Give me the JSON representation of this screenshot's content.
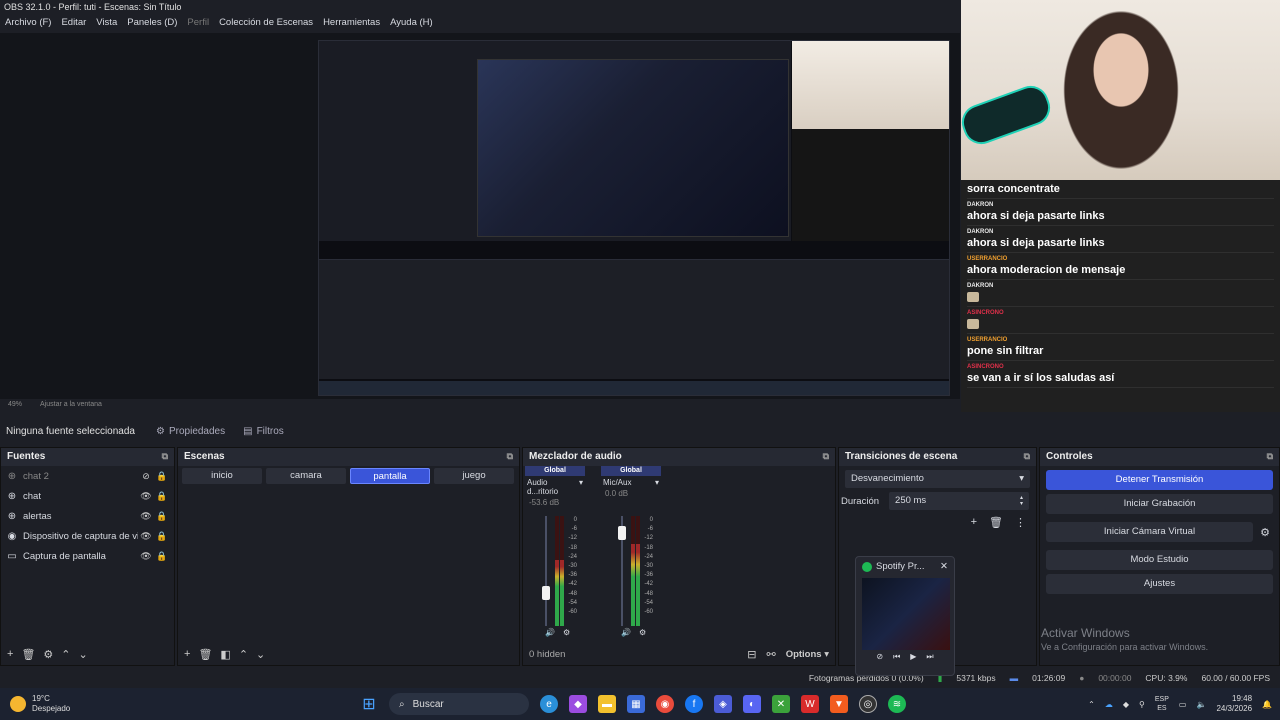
{
  "window": {
    "title": "OBS 32.1.0 - Perfil: tuti - Escenas: Sin Título"
  },
  "menu": [
    "Archivo (F)",
    "Editar",
    "Vista",
    "Paneles (D)",
    "Perfil",
    "Colección de Escenas",
    "Herramientas",
    "Ayuda (H)"
  ],
  "zoom": {
    "level": "49%",
    "fit": "Ajustar a la ventana"
  },
  "chat": {
    "messages": [
      {
        "user": "",
        "text": "sorra concentrate",
        "color": "#ffffff",
        "emote": false
      },
      {
        "user": "DAKRON",
        "text": "ahora si deja pasarte links",
        "color": "#e8e8e8",
        "emote": false
      },
      {
        "user": "DAKRON",
        "text": "ahora si deja pasarte links",
        "color": "#e8e8e8",
        "emote": false
      },
      {
        "user": "USERRANCIO",
        "text": "ahora moderacion de mensaje",
        "color": "#f0a030",
        "emote": false
      },
      {
        "user": "DAKRON",
        "text": "",
        "color": "#e8e8e8",
        "emote": true
      },
      {
        "user": "ASINCRONO",
        "text": "",
        "color": "#e0304a",
        "emote": true
      },
      {
        "user": "USERRANCIO",
        "text": "pone sin filtrar",
        "color": "#f0a030",
        "emote": false
      },
      {
        "user": "ASINCRONO",
        "text": "se van a ir sí los saludas así",
        "color": "#e0304a",
        "emote": false
      }
    ]
  },
  "toolbar": {
    "selected_source": "Ninguna fuente seleccionada",
    "properties": "Propiedades",
    "filters": "Filtros"
  },
  "sources": {
    "title": "Fuentes",
    "items": [
      {
        "name": "chat 2",
        "icon": "globe-icon",
        "hidden": true
      },
      {
        "name": "chat",
        "icon": "globe-icon",
        "hidden": false
      },
      {
        "name": "alertas",
        "icon": "globe-icon",
        "hidden": false
      },
      {
        "name": "Dispositivo de captura de video",
        "icon": "camera-icon",
        "hidden": false
      },
      {
        "name": "Captura de pantalla",
        "icon": "monitor-icon",
        "hidden": false
      }
    ]
  },
  "scenes": {
    "title": "Escenas",
    "items": [
      "inicio",
      "camara",
      "pantalla",
      "juego"
    ],
    "active": 2
  },
  "mixer": {
    "title": "Mezclador de audio",
    "channels": [
      {
        "badge": "Global",
        "name": "Audio d...ritorio",
        "db": "-53.6 dB",
        "level": 0.6,
        "fader": 0.3
      },
      {
        "badge": "Global",
        "name": "Mic/Aux",
        "db": "0.0 dB",
        "level": 0.75,
        "fader": 0.85
      }
    ],
    "ticks": [
      "0",
      "-6",
      "-12",
      "-18",
      "-24",
      "-30",
      "-36",
      "-42",
      "-48",
      "-54",
      "-60"
    ],
    "hidden": "0 hidden",
    "options": "Options"
  },
  "transitions": {
    "title": "Transiciones de escena",
    "selected": "Desvanecimiento",
    "duration_label": "Duración",
    "duration_value": "250 ms"
  },
  "controls": {
    "title": "Controles",
    "stop_stream": "Detener Transmisión",
    "start_recording": "Iniciar Grabación",
    "start_virtual_cam": "Iniciar Cámara Virtual",
    "studio_mode": "Modo Estudio",
    "settings": "Ajustes"
  },
  "spotify": {
    "title": "Spotify Pr..."
  },
  "watermark": {
    "line1": "Activar Windows",
    "line2": "Ve a Configuración para activar Windows."
  },
  "status": {
    "frames": "Fotogramas perdidos 0 (0.0%)",
    "bitrate": "5371 kbps",
    "live_time": "01:26:09",
    "rec_time": "00:00:00",
    "cpu": "CPU: 3.9%",
    "fps": "60.00 / 60.00 FPS"
  },
  "taskbar": {
    "temp": "19°C",
    "weather": "Despejado",
    "search": "Buscar",
    "lang1": "ESP",
    "lang2": "ES",
    "time": "19:48",
    "date": "24/3/2026"
  },
  "colors": {
    "accent": "#3a55d9",
    "live": "#2fa84a",
    "spotify": "#1db954"
  }
}
